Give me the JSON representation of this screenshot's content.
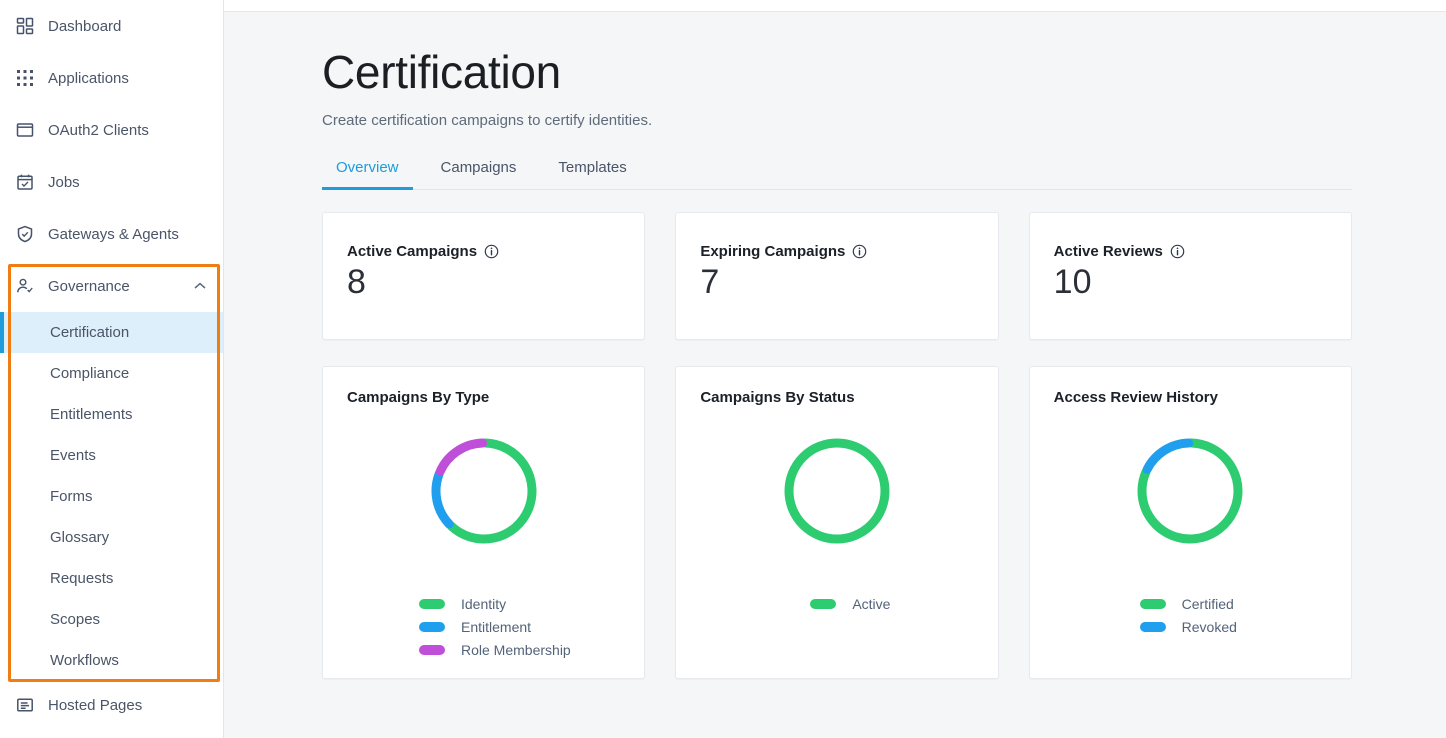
{
  "sidebar": {
    "items": [
      {
        "label": "Dashboard",
        "icon": "dashboard-icon"
      },
      {
        "label": "Applications",
        "icon": "applications-grid-icon"
      },
      {
        "label": "OAuth2 Clients",
        "icon": "window-icon"
      },
      {
        "label": "Jobs",
        "icon": "calendar-check-icon"
      },
      {
        "label": "Gateways & Agents",
        "icon": "shield-check-icon"
      }
    ],
    "governance": {
      "label": "Governance",
      "icon": "user-check-icon",
      "chevron": "chevron-up-icon",
      "expanded": true,
      "children": [
        {
          "label": "Certification",
          "active": true
        },
        {
          "label": "Compliance",
          "active": false
        },
        {
          "label": "Entitlements",
          "active": false
        },
        {
          "label": "Events",
          "active": false
        },
        {
          "label": "Forms",
          "active": false
        },
        {
          "label": "Glossary",
          "active": false
        },
        {
          "label": "Requests",
          "active": false
        },
        {
          "label": "Scopes",
          "active": false
        },
        {
          "label": "Workflows",
          "active": false
        }
      ]
    },
    "footer_item": {
      "label": "Hosted Pages",
      "icon": "document-lines-icon"
    },
    "active_highlight_color": "#ddeffa",
    "active_bar_color": "#1e9cdb",
    "annotation_box_color": "#f07d12"
  },
  "header": {
    "title": "Certification",
    "subtitle": "Create certification campaigns to certify identities."
  },
  "tabs": [
    {
      "label": "Overview",
      "active": true
    },
    {
      "label": "Campaigns",
      "active": false
    },
    {
      "label": "Templates",
      "active": false
    }
  ],
  "stats": [
    {
      "title": "Active Campaigns",
      "value": "8",
      "info": "info-icon"
    },
    {
      "title": "Expiring Campaigns",
      "value": "7",
      "info": "info-icon"
    },
    {
      "title": "Active Reviews",
      "value": "10",
      "info": "info-icon"
    }
  ],
  "colors": {
    "green": "#2ecc71",
    "blue": "#1f9fee",
    "purple": "#bf4fd8",
    "accent": "#1e9cdb",
    "page_bg": "#f4f6f8"
  },
  "chart_data": [
    {
      "type": "pie",
      "title": "Campaigns By Type",
      "donut": true,
      "labels": [
        "Identity",
        "Entitlement",
        "Role Membership"
      ],
      "values": [
        5,
        1.5,
        1.5
      ],
      "percentages": [
        62.5,
        18.75,
        18.75
      ],
      "colors": [
        "#2ecc71",
        "#1f9fee",
        "#bf4fd8"
      ],
      "legend_position": "bottom"
    },
    {
      "type": "pie",
      "title": "Campaigns By Status",
      "donut": true,
      "labels": [
        "Active"
      ],
      "values": [
        8
      ],
      "percentages": [
        100
      ],
      "colors": [
        "#2ecc71"
      ],
      "legend_position": "bottom"
    },
    {
      "type": "pie",
      "title": "Access Review History",
      "donut": true,
      "labels": [
        "Certified",
        "Revoked"
      ],
      "values": [
        8.2,
        1.8
      ],
      "percentages": [
        82,
        18
      ],
      "colors": [
        "#2ecc71",
        "#1f9fee"
      ],
      "legend_position": "bottom"
    }
  ]
}
